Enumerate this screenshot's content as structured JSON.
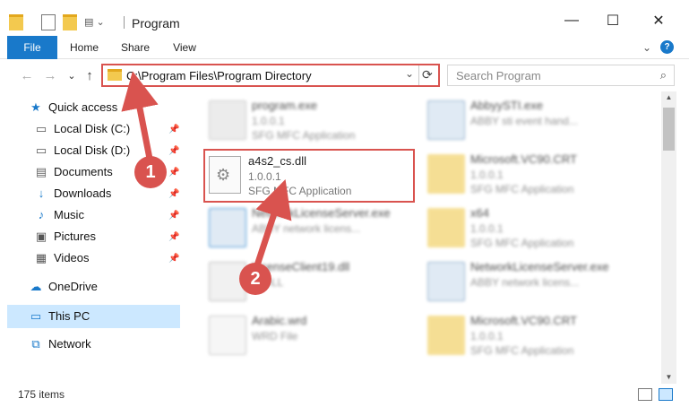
{
  "window": {
    "title": "Program",
    "minimize": "—",
    "maximize": "☐",
    "close": "✕"
  },
  "ribbon": {
    "tabs": [
      "File",
      "Home",
      "Share",
      "View"
    ],
    "expand": "⌄",
    "help": "?"
  },
  "nav": {
    "back": "←",
    "forward": "→",
    "recent": "⌄",
    "up": "↑"
  },
  "address": {
    "path": "C:\\Program Files\\Program Directory",
    "dropdown": "⌄",
    "refresh": "⟳"
  },
  "search": {
    "placeholder": "Search Program",
    "icon": "⌕"
  },
  "sidebar": {
    "items": [
      {
        "label": "Quick access",
        "icon": "★"
      },
      {
        "label": "Local Disk (C:)",
        "icon": "▭"
      },
      {
        "label": "Local Disk (D:)",
        "icon": "▭"
      },
      {
        "label": "Documents",
        "icon": "▤"
      },
      {
        "label": "Downloads",
        "icon": "↓"
      },
      {
        "label": "Music",
        "icon": "♪"
      },
      {
        "label": "Pictures",
        "icon": "▣"
      },
      {
        "label": "Videos",
        "icon": "▦"
      },
      {
        "label": "OneDrive",
        "icon": "☁"
      },
      {
        "label": "This PC",
        "icon": "▭"
      },
      {
        "label": "Network",
        "icon": "⧉"
      }
    ]
  },
  "files": [
    {
      "name": "program.exe",
      "version": "1.0.0.1",
      "type": "SFG MFC Application"
    },
    {
      "name": "AbbyySTI.exe",
      "version": "ABBY sti event hand...",
      "type": ""
    },
    {
      "name": "Microsoft.VC90.CRT",
      "version": "1.0.0.1",
      "type": "SFG MFC Application"
    },
    {
      "name": "NetworkLicenseServer.exe",
      "version": "ABBY network licens...",
      "type": ""
    },
    {
      "name": "x64",
      "version": "1.0.0.1",
      "type": "SFG MFC Application"
    },
    {
      "name": "LicenseClient19.dll",
      "version": "... DLL",
      "type": ""
    },
    {
      "name": "NetworkLicenseServer.exe",
      "version": "ABBY network licens...",
      "type": ""
    },
    {
      "name": "Arabic.wrd",
      "version": "WRD File",
      "type": ""
    },
    {
      "name": "Microsoft.VC90.CRT",
      "version": "1.0.0.1",
      "type": "SFG MFC Application"
    }
  ],
  "focus_file": {
    "name": "a4s2_cs.dll",
    "version": "1.0.0.1",
    "type": "SFG MFC Application"
  },
  "status": {
    "count": "175 items"
  },
  "annotations": {
    "step1": "1",
    "step2": "2",
    "color": "#d9534f"
  },
  "colors": {
    "accent": "#1979ca",
    "highlight": "#d9534f",
    "selected": "#cce8ff"
  }
}
